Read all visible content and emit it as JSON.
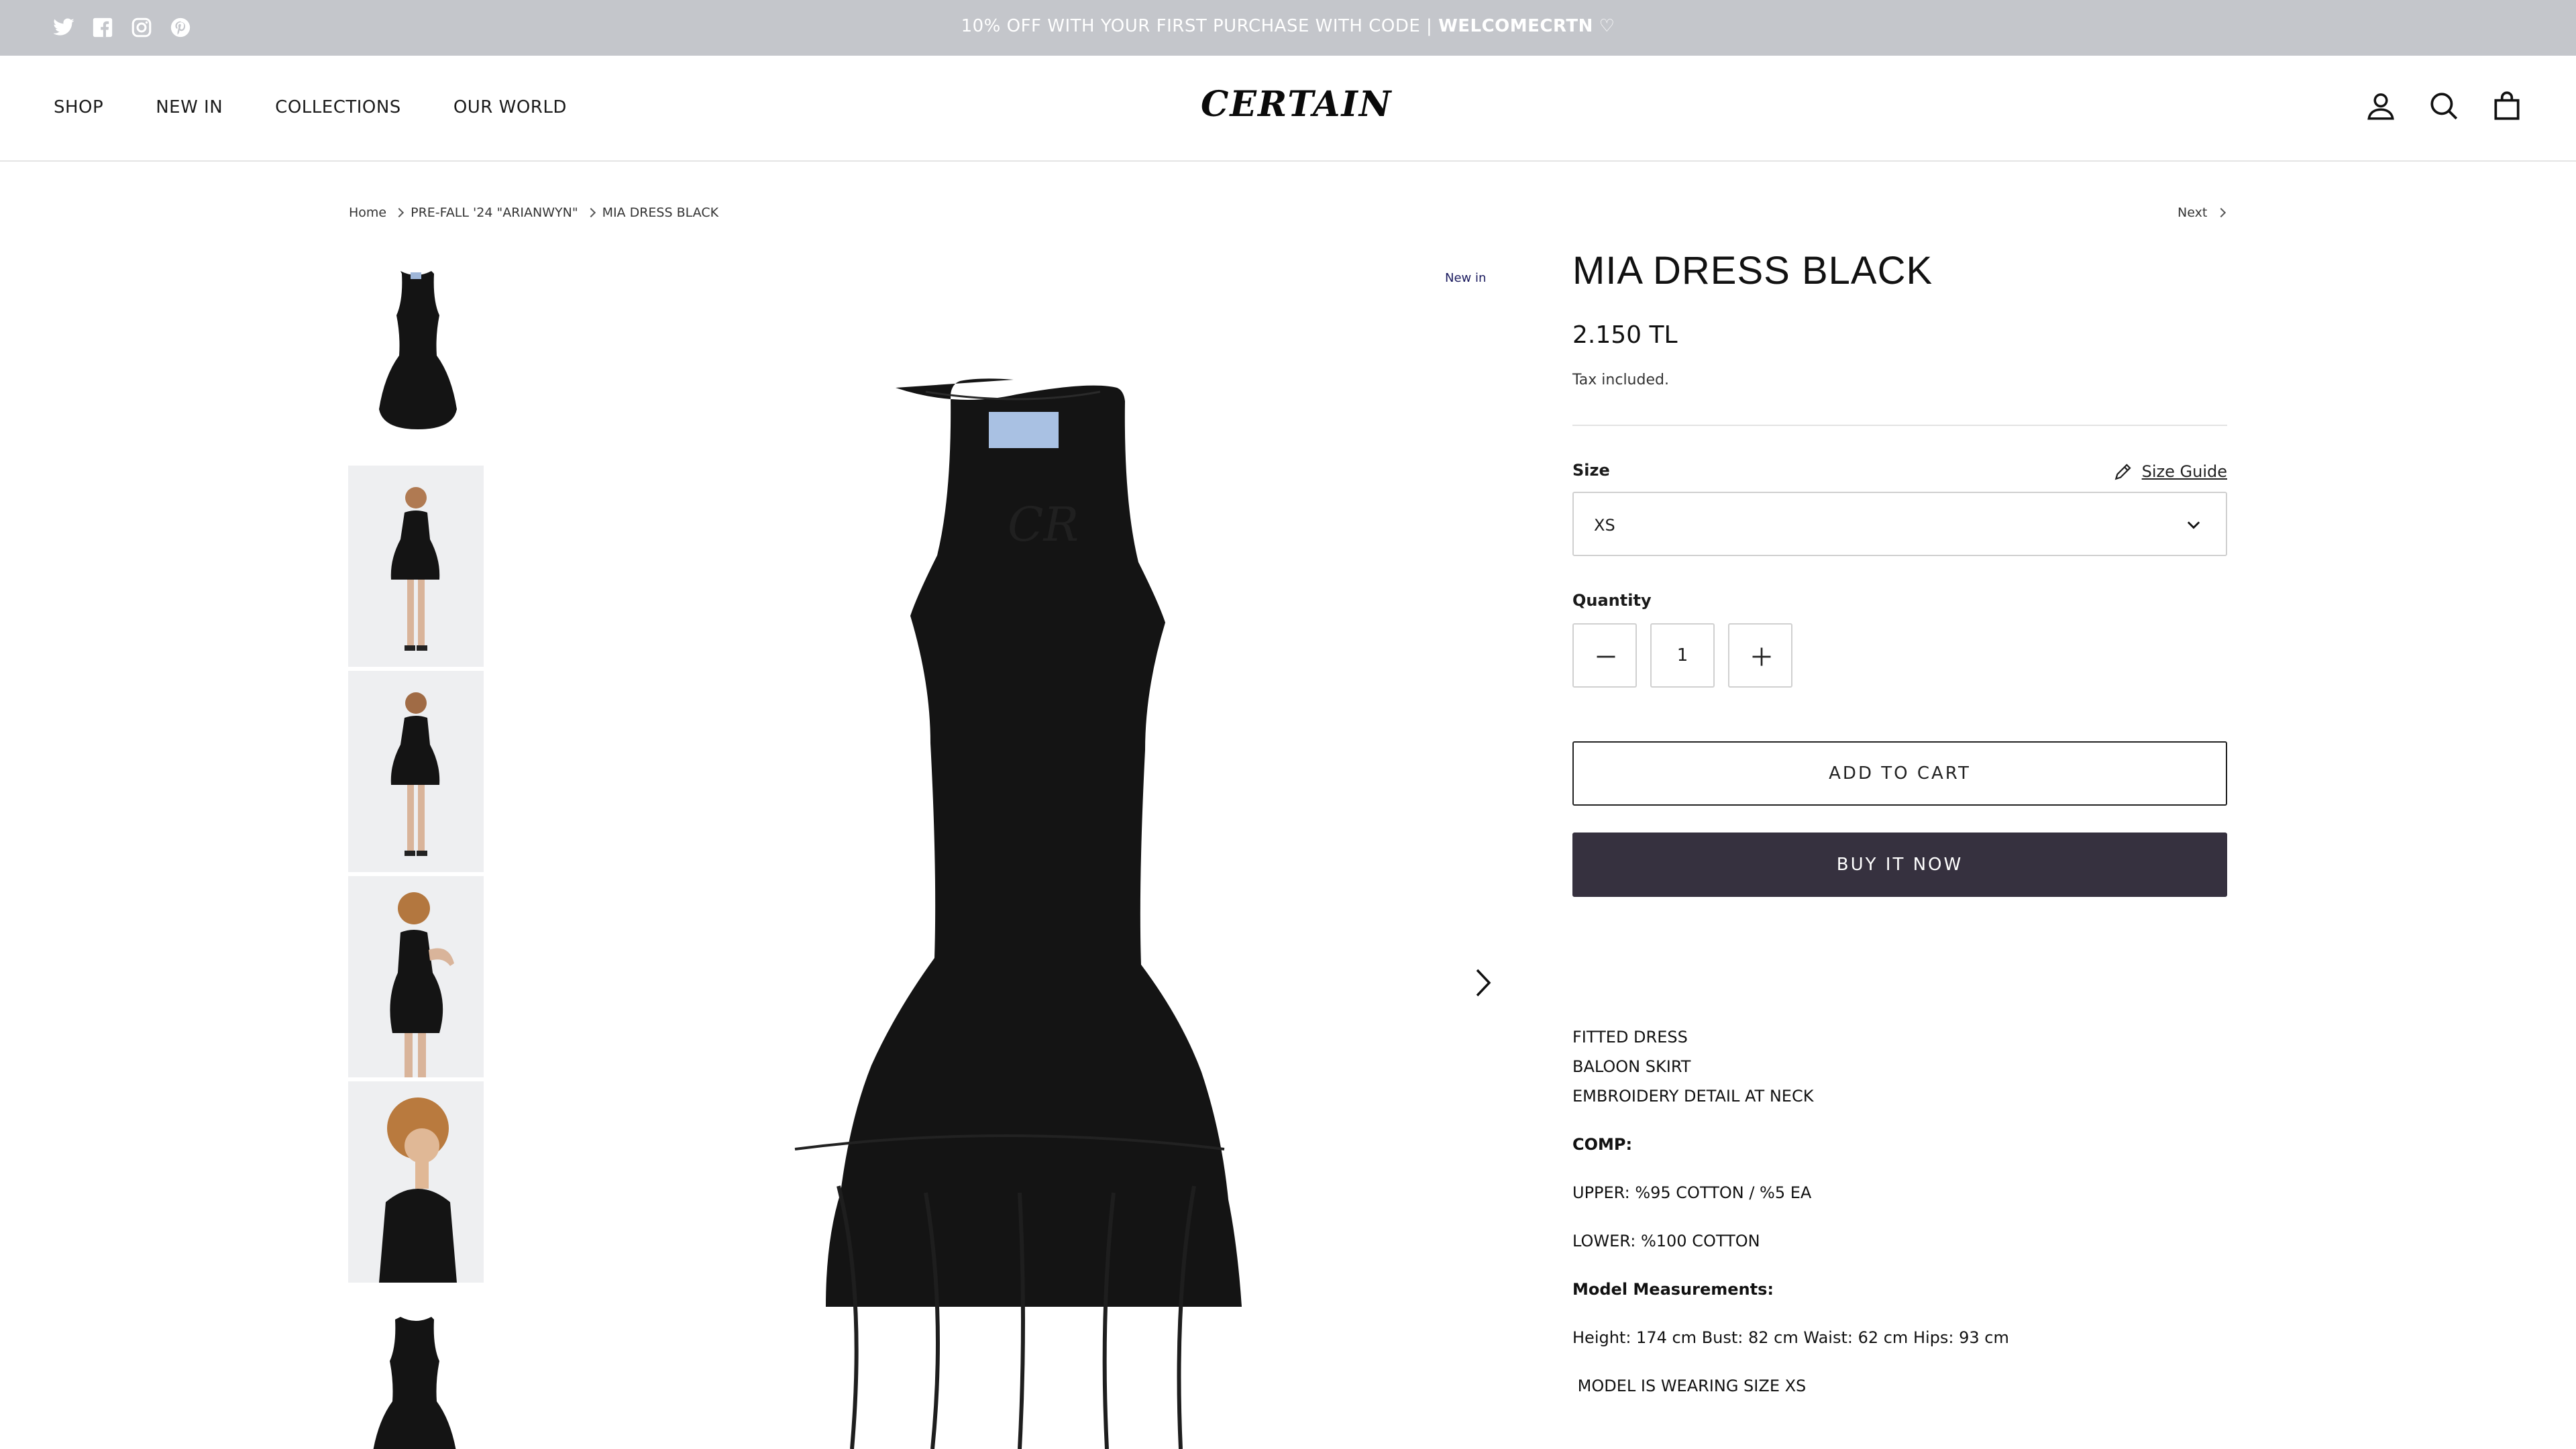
{
  "announcement": {
    "text": "10% OFF WITH YOUR FIRST PURCHASE WITH CODE | ",
    "code": "WELCOMECRTN",
    "heart": " ♡",
    "social_icons": [
      "twitter-icon",
      "facebook-icon",
      "instagram-icon",
      "pinterest-icon"
    ]
  },
  "header": {
    "nav": [
      "SHOP",
      "NEW IN",
      "COLLECTIONS",
      "OUR WORLD"
    ],
    "logo": "CERTAIN",
    "icons": [
      "account-icon",
      "search-icon",
      "cart-icon"
    ]
  },
  "breadcrumb": {
    "items": [
      "Home",
      "PRE-FALL '24 \"ARIANWYN\"",
      "MIA DRESS BLACK"
    ],
    "next": "Next"
  },
  "gallery": {
    "badge": "New in",
    "thumbnail_count": 6
  },
  "product": {
    "title": "MIA DRESS BLACK",
    "price": "2.150 TL",
    "tax_note": "Tax included.",
    "size_label": "Size",
    "size_guide": "Size Guide",
    "size_selected": "XS",
    "quantity_label": "Quantity",
    "quantity": "1",
    "add_to_cart": "ADD TO CART",
    "buy_now": "BUY IT NOW"
  },
  "description": {
    "features": [
      "FITTED DRESS",
      "BALOON SKIRT",
      "EMBROIDERY DETAIL AT NECK"
    ],
    "comp_label": "COMP:",
    "upper": "UPPER: %95 COTTON / %5 EA",
    "lower": "LOWER: %100 COTTON",
    "model_label": "Model Measurements:",
    "model_measurements": "Height: 174 cm Bust: 82 cm Waist: 62 cm Hips: 93 cm",
    "model_size": " MODEL IS WEARING SIZE XS"
  },
  "colors": {
    "announcement_bg": "#c4c6cb",
    "buy_button_bg": "#36313f",
    "dress": "#141414",
    "thumb_bg": "#f0f1f3"
  }
}
